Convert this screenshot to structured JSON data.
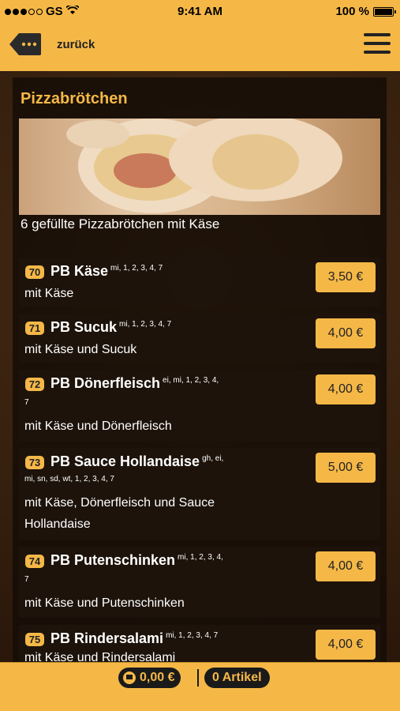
{
  "status_bar": {
    "carrier": "GS",
    "time": "9:41 AM",
    "battery": "100 %"
  },
  "nav": {
    "back_label": "zurück",
    "back_icon": "back-arrow-icon",
    "menu_icon": "hamburger-menu-icon"
  },
  "category": {
    "title": "Pizzabrötchen",
    "description": "6 gefüllte Pizzabrötchen mit Käse"
  },
  "items": [
    {
      "number": "70",
      "name": "PB Käse",
      "allergens": "mi, 1, 2, 3, 4, 7",
      "allergens_cont": "",
      "description": "mit Käse",
      "price": "3,50 €"
    },
    {
      "number": "71",
      "name": "PB Sucuk",
      "allergens": "mi, 1, 2, 3, 4, 7",
      "allergens_cont": "",
      "description": "mit Käse und Sucuk",
      "price": "4,00 €"
    },
    {
      "number": "72",
      "name": "PB Dönerfleisch",
      "allergens": "ei, mi, 1, 2, 3, 4,",
      "allergens_cont": "7",
      "description": "mit Käse und Dönerfleisch",
      "price": "4,00 €"
    },
    {
      "number": "73",
      "name": "PB Sauce Hollandaise",
      "allergens": "gh, ei,",
      "allergens_cont": "mi, sn, sd, wt, 1, 2, 3, 4, 7",
      "description": "mit Käse, Dönerfleisch und Sauce Hollandaise",
      "price": "5,00 €"
    },
    {
      "number": "74",
      "name": "PB Putenschinken",
      "allergens": "mi, 1, 2, 3, 4,",
      "allergens_cont": "7",
      "description": "mit Käse und Putenschinken",
      "price": "4,00 €"
    },
    {
      "number": "75",
      "name": "PB Rindersalami",
      "allergens": "mi, 1, 2, 3, 4, 7",
      "allergens_cont": "",
      "description": "mit Käse und Rindersalami",
      "price": "4,00 €"
    }
  ],
  "footer": {
    "cart_total": "0,00 €",
    "item_count": "0 Artikel",
    "cart_icon": "cart-icon"
  },
  "colors": {
    "accent": "#f5b847",
    "dark": "#1a1a1a",
    "panel": "#140c06"
  }
}
